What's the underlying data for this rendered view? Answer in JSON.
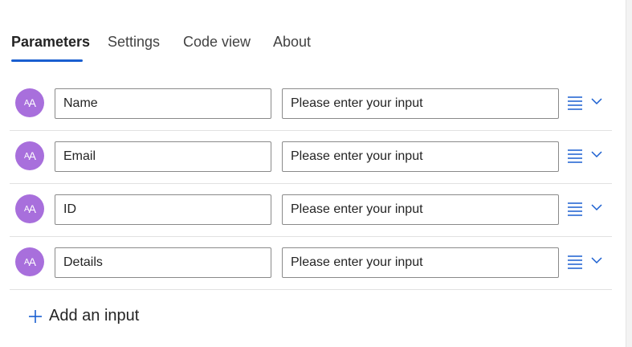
{
  "tabs": [
    {
      "label": "Parameters",
      "active": true
    },
    {
      "label": "Settings",
      "active": false
    },
    {
      "label": "Code view",
      "active": false
    },
    {
      "label": "About",
      "active": false
    }
  ],
  "inputs": [
    {
      "name": "Name",
      "placeholder": "Please enter your input"
    },
    {
      "name": "Email",
      "placeholder": "Please enter your input"
    },
    {
      "name": "ID",
      "placeholder": "Please enter your input"
    },
    {
      "name": "Details",
      "placeholder": "Please enter your input"
    }
  ],
  "avatar_icon": "text-type-icon",
  "add_input_label": "Add an input",
  "colors": {
    "accent": "#1a5fd0",
    "avatar": "#a86fdc",
    "icon": "#1a5fd0"
  }
}
